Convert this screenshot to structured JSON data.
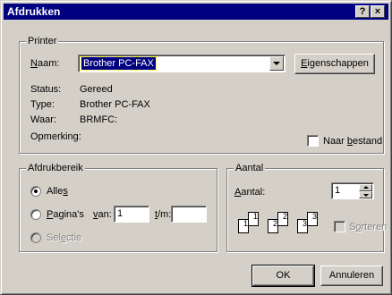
{
  "window": {
    "title": "Afdrukken",
    "help_label": "?",
    "close_label": "×"
  },
  "printer": {
    "legend": "Printer",
    "name_label": "Naam:",
    "name_value": "Brother PC-FAX",
    "properties_button": "Eigenschappen",
    "status_label": "Status:",
    "status_value": "Gereed",
    "type_label": "Type:",
    "type_value": "Brother PC-FAX",
    "where_label": "Waar:",
    "where_value": "BRMFC:",
    "comment_label": "Opmerking:",
    "print_to_file_label": "Naar bestand",
    "print_to_file_checked": false
  },
  "range": {
    "legend": "Afdrukbereik",
    "all_label": "Alles",
    "pages_label": "Pagina's",
    "from_label": "van:",
    "from_value": "1",
    "to_label": "t/m:",
    "to_value": "",
    "selection_label": "Selectie",
    "selected": "all"
  },
  "copies": {
    "legend": "Aantal",
    "count_label": "Aantal:",
    "count_value": "1",
    "collate_label": "Sorteren",
    "collate_checked": false,
    "page_numbers": [
      "1",
      "1",
      "2",
      "2",
      "3",
      "3"
    ]
  },
  "buttons": {
    "ok": "OK",
    "cancel": "Annuleren"
  }
}
